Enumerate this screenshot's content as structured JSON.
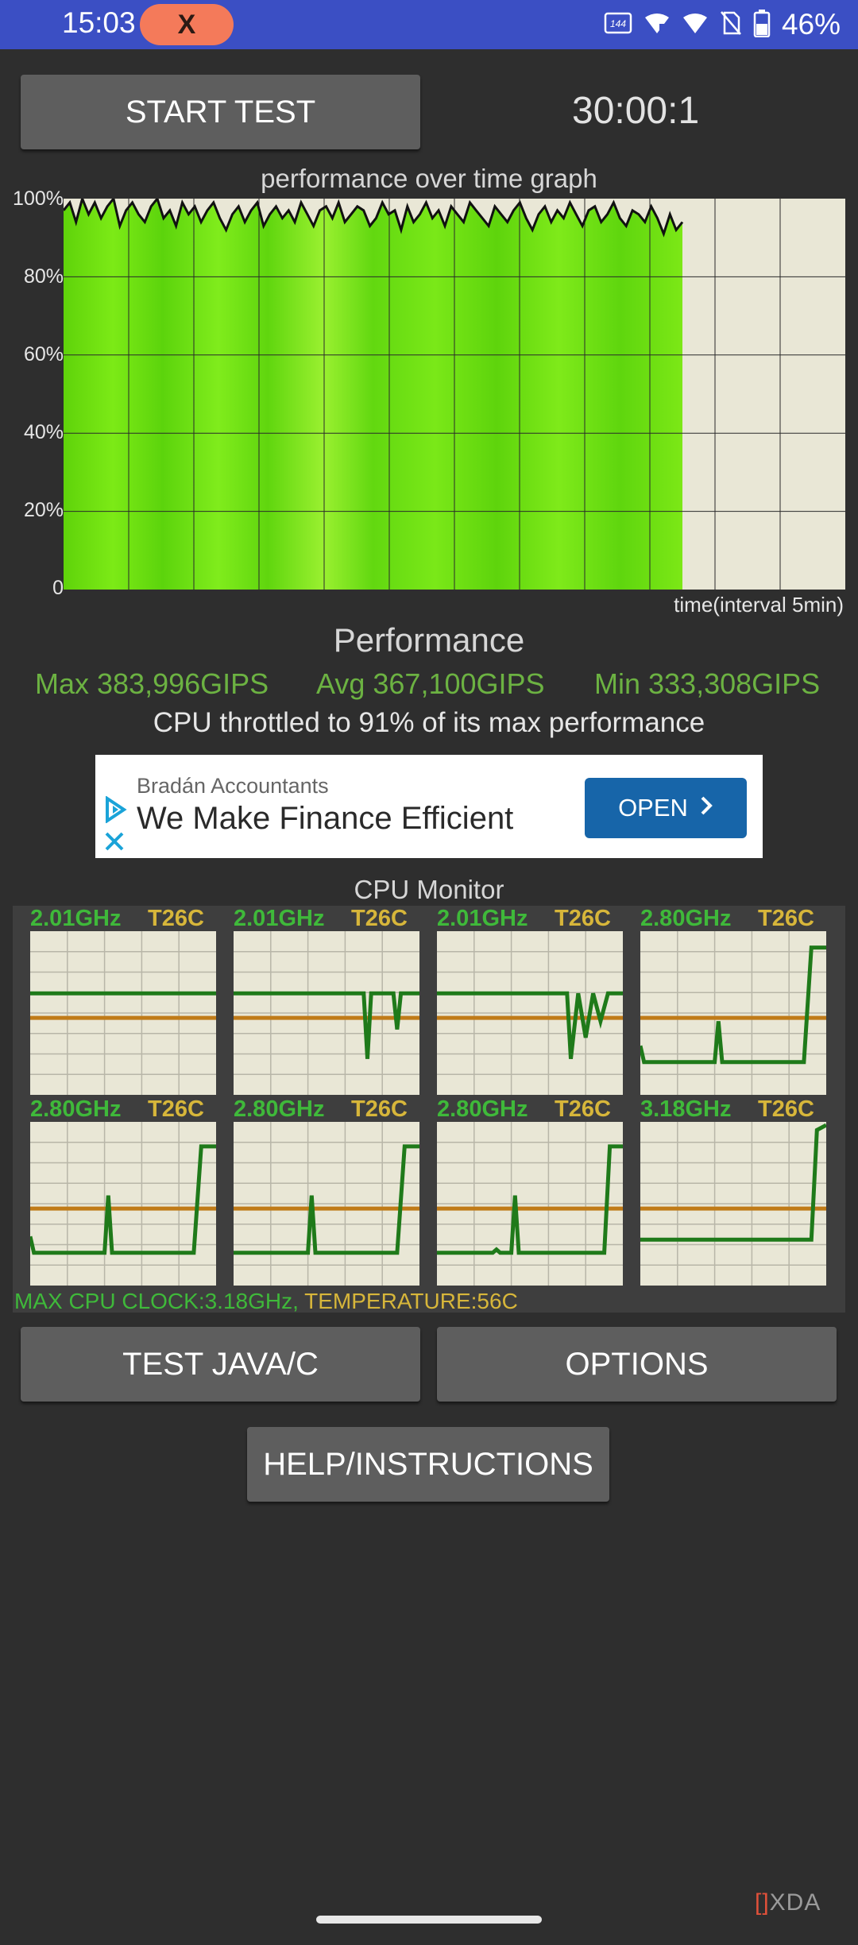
{
  "status_bar": {
    "time": "15:03",
    "app_badge": "X",
    "refresh_icon_label": "144 Hz",
    "battery": "46%",
    "icons": [
      "hz-icon",
      "hotspot-icon",
      "wifi-icon",
      "no-sim-icon",
      "battery-icon"
    ]
  },
  "controls": {
    "start_test": "START TEST",
    "timer": "30:00:1"
  },
  "performance_graph": {
    "title": "performance over time graph",
    "y_ticks": [
      "100%",
      "80%",
      "60%",
      "40%",
      "20%",
      "0"
    ],
    "x_label": "time(interval 5min)",
    "chart_data": {
      "type": "area",
      "ylim": [
        0,
        100
      ],
      "x_intervals_total": 6,
      "x_intervals_completed": 4.75,
      "values": [
        97,
        99,
        94,
        100,
        96,
        99,
        95,
        98,
        100,
        93,
        97,
        99,
        96,
        94,
        98,
        100,
        95,
        97,
        93,
        99,
        96,
        98,
        94,
        97,
        99,
        95,
        92,
        96,
        98,
        94,
        97,
        99,
        93,
        96,
        98,
        95,
        97,
        94,
        99,
        96,
        93,
        97,
        98,
        95,
        99,
        94,
        96,
        98,
        97,
        93,
        95,
        99,
        96,
        97,
        92,
        98,
        94,
        96,
        99,
        95,
        97,
        93,
        98,
        96,
        94,
        99,
        97,
        95,
        93,
        98,
        96,
        94,
        97,
        99,
        95,
        92,
        96,
        98,
        94,
        97,
        95,
        99,
        96,
        93,
        97,
        98,
        94,
        96,
        99,
        95,
        93,
        97,
        96,
        94,
        98,
        95,
        91,
        96,
        92,
        94
      ]
    },
    "colors": {
      "fill": "#6ee20c",
      "line": "#111111",
      "bg": "#e9e7d6"
    }
  },
  "performance": {
    "title": "Performance",
    "max": "Max 383,996GIPS",
    "avg": "Avg 367,100GIPS",
    "min": "Min 333,308GIPS",
    "throttle_text": "CPU throttled to 91% of its max performance"
  },
  "ad": {
    "advertiser": "Bradán Accountants",
    "headline": "We Make Finance Efficient",
    "cta": "OPEN"
  },
  "cpu_monitor": {
    "title": "CPU Monitor",
    "cores": [
      {
        "freq": "2.01GHz",
        "temp": "T26C"
      },
      {
        "freq": "2.01GHz",
        "temp": "T26C"
      },
      {
        "freq": "2.01GHz",
        "temp": "T26C"
      },
      {
        "freq": "2.80GHz",
        "temp": "T26C"
      },
      {
        "freq": "2.80GHz",
        "temp": "T26C"
      },
      {
        "freq": "2.80GHz",
        "temp": "T26C"
      },
      {
        "freq": "2.80GHz",
        "temp": "T26C"
      },
      {
        "freq": "3.18GHz",
        "temp": "T26C"
      }
    ],
    "footer_clock": "MAX CPU CLOCK:3.18GHz,",
    "footer_temp": " TEMPERATURE:56C"
  },
  "buttons": {
    "test_java_c": "TEST JAVA/C",
    "options": "OPTIONS",
    "help": "HELP/INSTRUCTIONS"
  },
  "watermark": "XDA"
}
